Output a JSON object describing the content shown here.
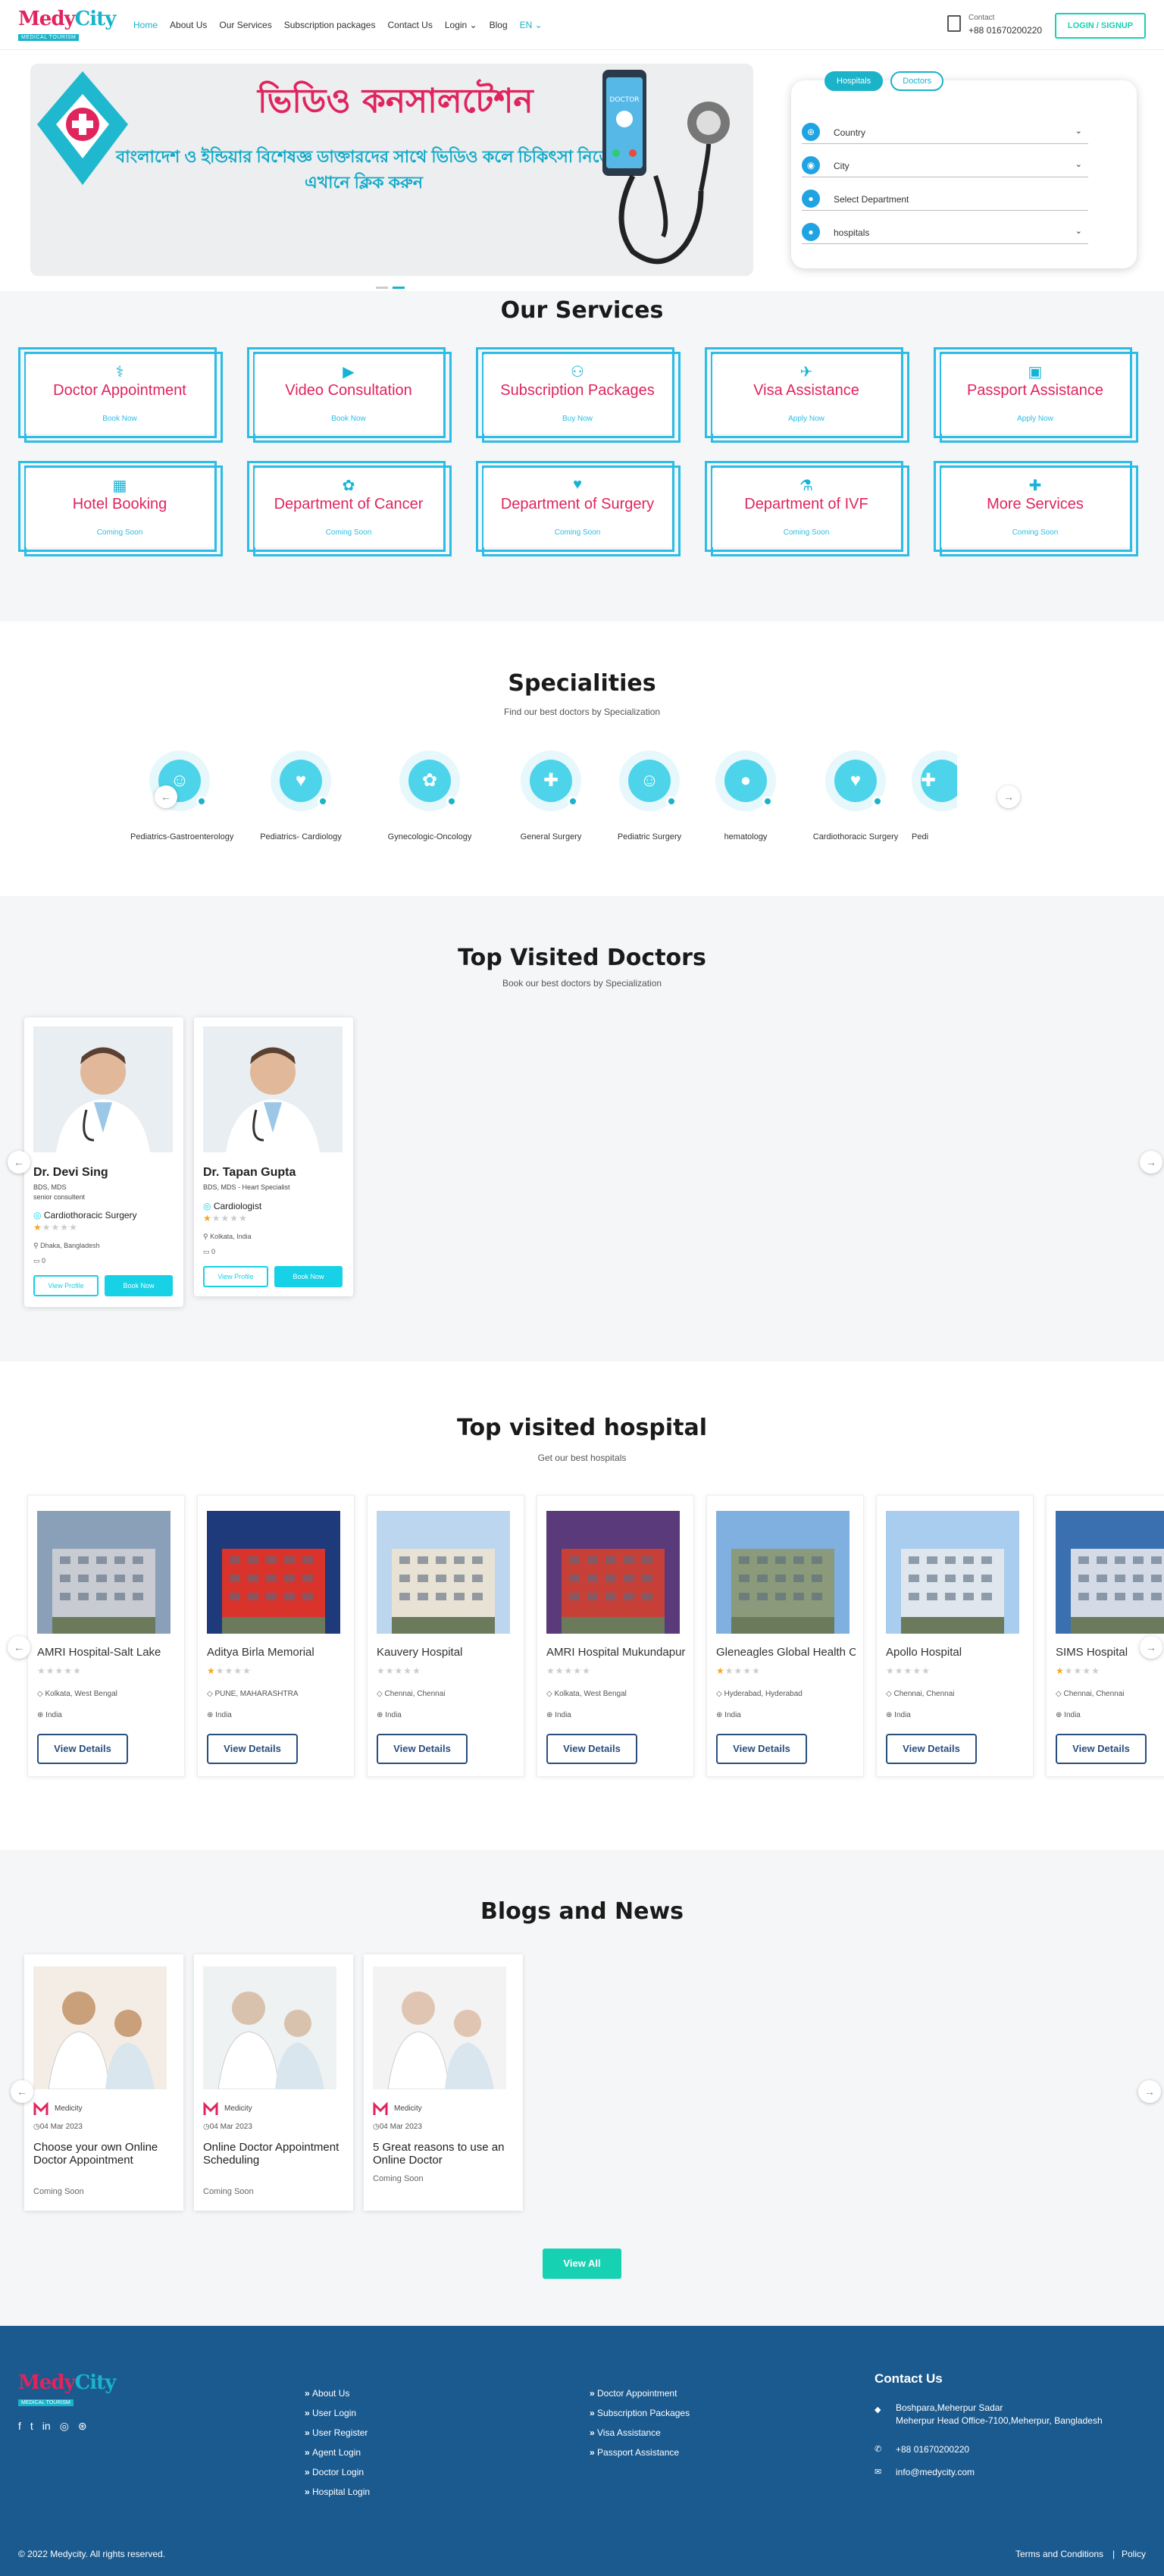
{
  "header": {
    "logo_main_1": "Medy",
    "logo_main_2": "City",
    "logo_tag": "MEDICAL TOURISM",
    "nav": [
      "Home",
      "About Us",
      "Our Services",
      "Subscription packages",
      "Contact Us",
      "Login ⌄",
      "Blog",
      "EN ⌄"
    ],
    "contact_label": "Contact",
    "contact_phone": "+88 01670200220",
    "login": "LOGIN / SIGNUP"
  },
  "hero": {
    "title": "ভিডিও কনসালটেশন",
    "subtitle": "বাংলাদেশ ও ইন্ডিয়ার বিশেষজ্ঞ ডাক্তারদের সাথে ভিডিও কলে চিকিৎসা নিতে এখানে ক্লিক করুন",
    "phone_text": "DOCTOR"
  },
  "search": {
    "tabs": [
      "Hospitals",
      "Doctors"
    ],
    "fields": [
      "Country",
      "City",
      "Select Department",
      "hospitals"
    ]
  },
  "services": {
    "title": "Our Services",
    "items": [
      {
        "name": "Doctor Appointment",
        "action": "Book Now",
        "icon": "doctor-icon"
      },
      {
        "name": "Video Consultation",
        "action": "Book Now",
        "icon": "video-icon"
      },
      {
        "name": "Subscription Packages",
        "action": "Buy Now",
        "icon": "group-icon"
      },
      {
        "name": "Visa Assistance",
        "action": "Apply Now",
        "icon": "visa-icon"
      },
      {
        "name": "Passport Assistance",
        "action": "Apply Now",
        "icon": "passport-icon"
      },
      {
        "name": "Hotel Booking",
        "action": "Coming Soon",
        "icon": "hotel-icon"
      },
      {
        "name": "Department of Cancer",
        "action": "Coming Soon",
        "icon": "ribbon-icon"
      },
      {
        "name": "Department of Surgery",
        "action": "Coming Soon",
        "icon": "heart-monitor-icon"
      },
      {
        "name": "Department of IVF",
        "action": "Coming Soon",
        "icon": "ivf-icon"
      },
      {
        "name": "More Services",
        "action": "Coming Soon",
        "icon": "plus-icon"
      }
    ]
  },
  "specialities": {
    "title": "Specialities",
    "subtitle": "Find our best doctors by Specialization",
    "items": [
      "Pediatrics-Gastroenterology",
      "Pediatrics- Cardiology",
      "Gynecologic-Oncology",
      "General Surgery",
      "Pediatric Surgery",
      "hematology",
      "Cardiothoracic Surgery",
      "Pedi"
    ]
  },
  "doctors": {
    "title": "Top Visited Doctors",
    "subtitle": "Book our best doctors by Specialization",
    "items": [
      {
        "name": "Dr. Devi Sing",
        "degree": "BDS, MDS",
        "position": "senior consultent",
        "speciality": "Cardiothoracic Surgery",
        "rating": 1,
        "location": "Dhaka, Bangladesh",
        "exp": "0"
      },
      {
        "name": "Dr. Tapan Gupta",
        "degree": "BDS, MDS - Heart Specialist",
        "position": "",
        "speciality": "Cardiologist",
        "rating": 1,
        "location": "Kolkata, India",
        "exp": "0"
      }
    ],
    "view": "View Profile",
    "book": "Book Now"
  },
  "hospitals": {
    "title": "Top visited hospital",
    "subtitle": "Get our best hospitals",
    "items": [
      {
        "name": "AMRI Hospital-Salt Lake",
        "rating": 0,
        "city": "Kolkata, West Bengal",
        "country": "India"
      },
      {
        "name": "Aditya Birla Memorial",
        "rating": 1,
        "city": "PUNE, MAHARASHTRA",
        "country": "India"
      },
      {
        "name": "Kauvery Hospital",
        "rating": 0,
        "city": "Chennai, Chennai",
        "country": "India"
      },
      {
        "name": "AMRI Hospital Mukundapur",
        "rating": 0,
        "city": "Kolkata, West Bengal",
        "country": "India"
      },
      {
        "name": "Gleneagles Global Health City",
        "rating": 1,
        "city": "Hyderabad, Hyderabad",
        "country": "India"
      },
      {
        "name": "Apollo Hospital",
        "rating": 0,
        "city": "Chennai, Chennai",
        "country": "India"
      },
      {
        "name": "SIMS Hospital",
        "rating": 1,
        "city": "Chennai, Chennai",
        "country": "India"
      }
    ],
    "button": "View Details"
  },
  "blogs": {
    "title": "Blogs and News",
    "items": [
      {
        "author": "Medicity",
        "date": "04 Mar 2023",
        "title": "Choose your own Online Doctor Appointment",
        "status": "Coming Soon"
      },
      {
        "author": "Medicity",
        "date": "04 Mar 2023",
        "title": "Online Doctor Appointment Scheduling",
        "status": "Coming Soon"
      },
      {
        "author": "Medicity",
        "date": "04 Mar 2023",
        "title": "5 Great reasons to use an Online Doctor",
        "status": "Coming Soon"
      }
    ],
    "view_all": "View All"
  },
  "footer": {
    "links1": [
      "About Us",
      "User Login",
      "User Register",
      "Agent Login",
      "Doctor Login",
      "Hospital Login"
    ],
    "links2": [
      "Doctor Appointment",
      "Subscription Packages",
      "Visa Assistance",
      "Passport Assistance"
    ],
    "contact_title": "Contact Us",
    "address": "Boshpara,Meherpur Sadar\nMeherpur Head Office-7100,Meherpur, Bangladesh",
    "phone": "+88 01670200220",
    "email": "info@medycity.com",
    "copyright": "© 2022 Medycity. All rights reserved.",
    "terms": "Terms and Conditions",
    "policy": "Policy"
  },
  "colors": {
    "brand_pink": "#e0245e",
    "brand_cyan": "#1ab3c9",
    "accent_teal": "#17d1b3",
    "footer": "#1b5a8f"
  }
}
